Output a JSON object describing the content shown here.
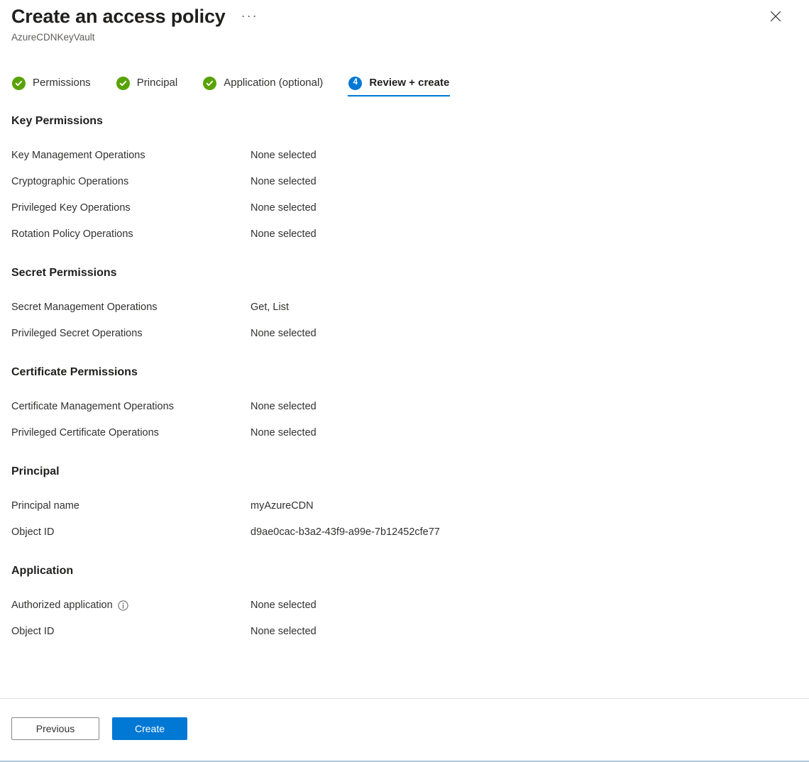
{
  "header": {
    "title": "Create an access policy",
    "subtitle": "AzureCDNKeyVault",
    "more_label": "···",
    "close_label": "close-icon"
  },
  "tabs": [
    {
      "label": "Permissions",
      "state": "done",
      "badge": ""
    },
    {
      "label": "Principal",
      "state": "done",
      "badge": ""
    },
    {
      "label": "Application (optional)",
      "state": "done",
      "badge": ""
    },
    {
      "label": "Review + create",
      "state": "current",
      "badge": "4"
    }
  ],
  "sections": [
    {
      "heading": "Key Permissions",
      "rows": [
        {
          "label": "Key Management Operations",
          "value": "None selected"
        },
        {
          "label": "Cryptographic Operations",
          "value": "None selected"
        },
        {
          "label": "Privileged Key Operations",
          "value": "None selected"
        },
        {
          "label": "Rotation Policy Operations",
          "value": "None selected"
        }
      ]
    },
    {
      "heading": "Secret Permissions",
      "rows": [
        {
          "label": "Secret Management Operations",
          "value": "Get, List"
        },
        {
          "label": "Privileged Secret Operations",
          "value": "None selected"
        }
      ]
    },
    {
      "heading": "Certificate Permissions",
      "rows": [
        {
          "label": "Certificate Management Operations",
          "value": "None selected"
        },
        {
          "label": "Privileged Certificate Operations",
          "value": "None selected"
        }
      ]
    },
    {
      "heading": "Principal",
      "rows": [
        {
          "label": "Principal name",
          "value": "myAzureCDN"
        },
        {
          "label": "Object ID",
          "value": "d9ae0cac-b3a2-43f9-a99e-7b12452cfe77"
        }
      ]
    },
    {
      "heading": "Application",
      "rows": [
        {
          "label": "Authorized application",
          "value": "None selected",
          "info": true
        },
        {
          "label": "Object ID",
          "value": "None selected"
        }
      ]
    }
  ],
  "footer": {
    "previous_label": "Previous",
    "create_label": "Create"
  },
  "colors": {
    "accent": "#0078d4",
    "success": "#57a300",
    "text": "#323130",
    "muted": "#605e5c",
    "divider": "#e1dfdd",
    "blade_edge": "#a9c8de"
  }
}
